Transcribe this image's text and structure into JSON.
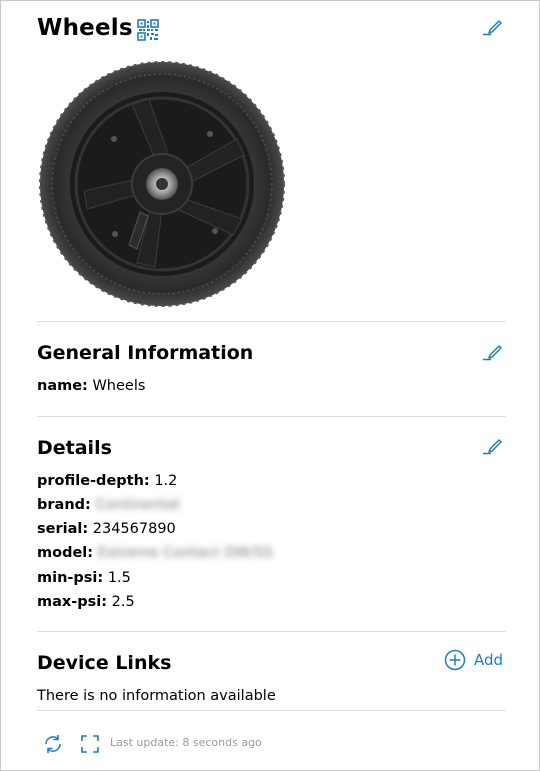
{
  "header": {
    "title": "Wheels",
    "icons": [
      "qr-code-icon",
      "pencil-icon"
    ]
  },
  "image": {
    "alt": "wheel-photo"
  },
  "general": {
    "title": "General Information",
    "fields": [
      {
        "label": "name:",
        "value": "Wheels"
      }
    ]
  },
  "details": {
    "title": "Details",
    "fields": [
      {
        "label": "profile-depth:",
        "value": "1.2"
      },
      {
        "label": "brand:",
        "value": "Continental",
        "blurred": true
      },
      {
        "label": "serial:",
        "value": "234567890"
      },
      {
        "label": "model:",
        "value": "Extreme Contact DW/SS",
        "blurred": true
      },
      {
        "label": "min-psi:",
        "value": "1.5"
      },
      {
        "label": "max-psi:",
        "value": "2.5"
      }
    ]
  },
  "device_links": {
    "title": "Device Links",
    "add_label": "Add",
    "empty_text": "There is no information available"
  },
  "footer": {
    "last_update": "Last update: 8 seconds ago",
    "icons": [
      "refresh-icon",
      "fullscreen-icon"
    ]
  },
  "colors": {
    "accent": "#1d7ec0",
    "divider": "#dcdcdc",
    "muted": "#9a9a9a"
  }
}
